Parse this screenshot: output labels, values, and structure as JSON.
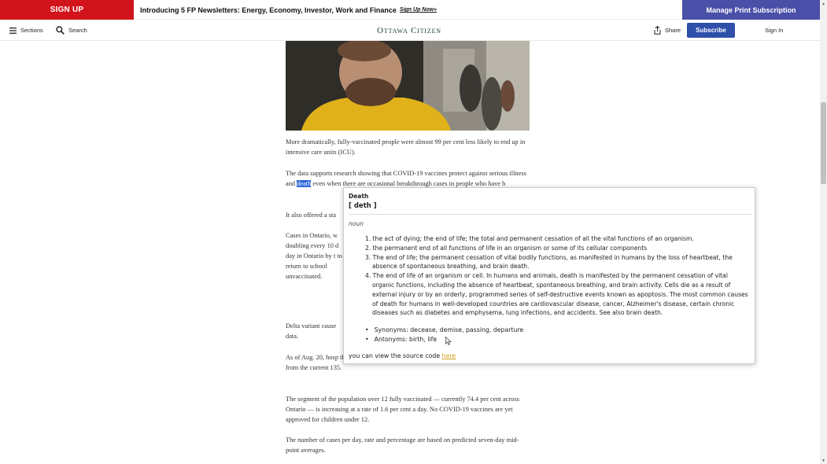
{
  "promo": {
    "signup_label": "SIGN UP",
    "text": "Introducing 5 FP Newsletters: Energy, Economy, Investor, Work and Finance",
    "link": "Sign Up Now»",
    "print_label": "Manage Print Subscription"
  },
  "nav": {
    "sections_label": "Sections",
    "search_label": "Search",
    "logo": "Ottawa Citizen",
    "share_label": "Share",
    "subscribe_label": "Subscribe",
    "signin_label": "Sign In"
  },
  "article": {
    "p1": "More dramatically, fully-vaccinated people were almost 99 per cent less likely to end up in intensive care units (ICU).",
    "p2_before": "The data supports research showing that COVID-19 vaccines protect against serious illness and ",
    "p2_highlight": "death",
    "p2_after": " even when there are occasional breakthrough cases in people who have b",
    "p3": "It also offered a sta",
    "p4": "Cases in Ontario, w doubling every 10 d day in Ontario by t to return to school unvaccinated.",
    "p5": "Delta variant cause data.",
    "p6": "As of Aug. 20, hosp the current 228 and ICU capacity was forecast to increase by 24 a week from the current 135.",
    "p7": "The segment of the population over 12 fully vaccinated — currently 74.4 per cent across Ontario — is increasing at a rate of 1.6 per cent a day. No COVID-19 vaccines are yet approved for children under 12.",
    "p8": "The number of cases per day, rate and percentage are based on predicted seven-day mid-point averages."
  },
  "popup": {
    "word": "Death",
    "phonetic": "[ deth ]",
    "pos": "noun",
    "definitions": [
      "1. the act of dying; the end of life; the total and permanent cessation of all the vital functions of an organism.",
      "2. the permanent end of all functions of life in an organism or some of its cellular components",
      "3. The end of life; the permanent cessation of vital bodily functions, as manifested in humans by the loss of heartbeat, the absence of spontaneous breathing, and brain death.",
      "4. The end of life of an organism or cell. In humans and animals, death is manifested by the permanent cessation of vital organic functions, including the absence of heartbeat, spontaneous breathing, and brain activity. Cells die as a result of external injury or by an orderly, programmed series of self-destructive events known as apoptosis. The most common causes of death for humans in well-developed countries are cardiovascular disease, cancer, Alzheimer's disease, certain chronic diseases such as diabetes and emphysema, lung infections, and accidents. See also brain death."
    ],
    "synonyms": "Synonyms: decease, demise, passing, departure",
    "antonyms": "Antonyms: birth, life",
    "source_text": "you can view the source code ",
    "source_link": "here"
  },
  "colors": {
    "signup_red": "#d1141b",
    "print_purple": "#4a4fa8",
    "subscribe_blue": "#2e4faa",
    "highlight_blue": "#2b66d8",
    "link_gold": "#d4a017"
  }
}
